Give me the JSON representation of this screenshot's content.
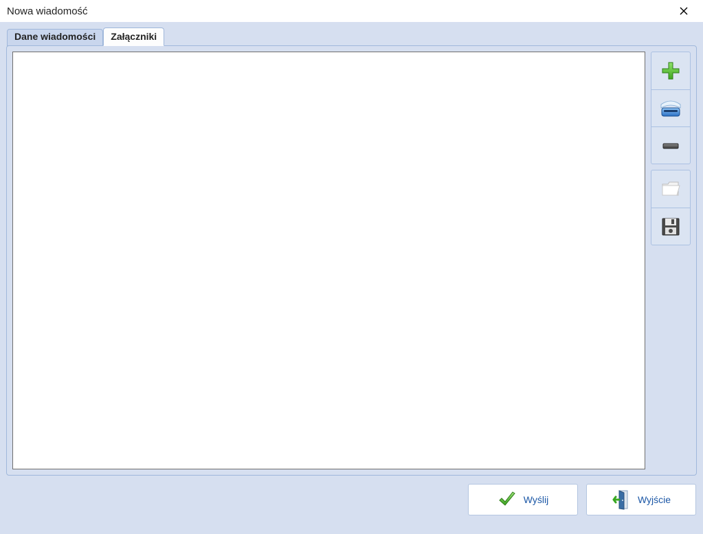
{
  "window": {
    "title": "Nowa wiadomość"
  },
  "tabs": {
    "message_data": "Dane wiadomości",
    "attachments": "Załączniki",
    "active": "attachments"
  },
  "side_buttons": {
    "add": "add-icon",
    "scan": "scanner-icon",
    "remove": "remove-icon",
    "open_folder": "folder-icon",
    "save": "floppy-save-icon"
  },
  "footer": {
    "send_label": "Wyślij",
    "exit_label": "Wyjście"
  }
}
